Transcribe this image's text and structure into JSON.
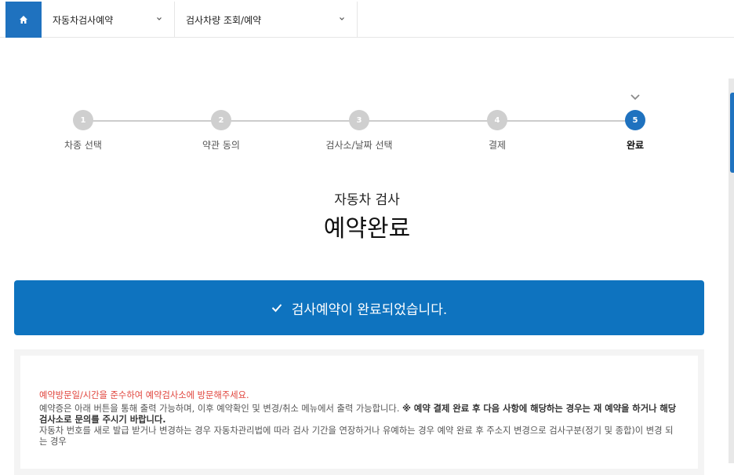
{
  "breadcrumb": {
    "item1": "자동차검사예약",
    "item2": "검사차량 조회/예약"
  },
  "steps": [
    {
      "num": "1",
      "label": "차종 선택"
    },
    {
      "num": "2",
      "label": "약관 동의"
    },
    {
      "num": "3",
      "label": "검사소/날짜 선택"
    },
    {
      "num": "4",
      "label": "결제"
    },
    {
      "num": "5",
      "label": "완료"
    }
  ],
  "title": {
    "sub": "자동차 검사",
    "main": "예약완료"
  },
  "banner": {
    "text": "검사예약이 완료되었습니다."
  },
  "notice": {
    "red_line": "예약방문일/시간을 준수하여 예약검사소에 방문해주세요.",
    "line1_normal": "예약증은 아래 버튼을 통해 출력 가능하며, 이후 예약확인 및 변경/취소 메뉴에서 출력 가능합니다. ",
    "line1_bold": "※ 예약 결제 완료 후 다음 사항에 해당하는 경우는 재 예약을 하거나 해당 검사소로 문의를 주시기 바랍니다.",
    "line2": "자동차 번호를 새로 발급 받거나 변경하는 경우 자동차관리법에 따라 검사 기간을 연장하거나 유예하는 경우 예약 완료 후 주소지 변경으로 검사구분(정기 및 종합)이 변경 되는 경우"
  },
  "colors": {
    "accent": "#1f72bf",
    "banner": "#0e73bf",
    "warning": "#e0443c"
  }
}
